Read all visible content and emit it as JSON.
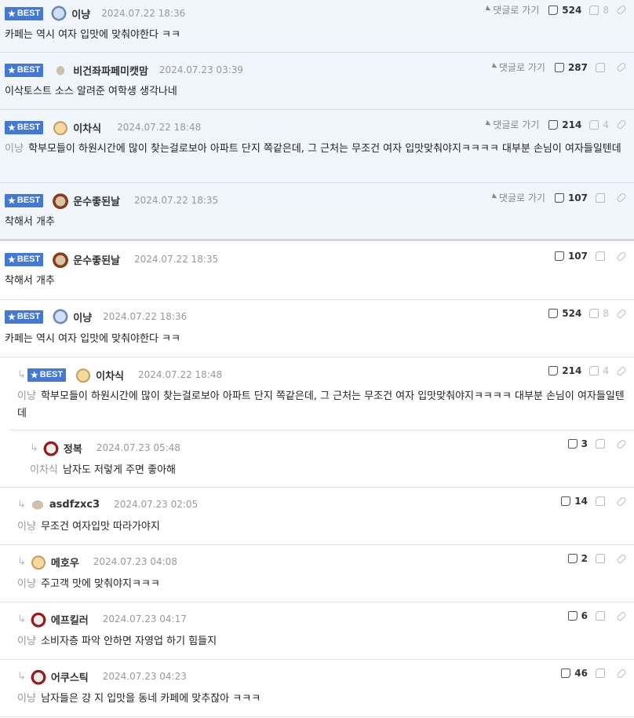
{
  "best_comments": [
    {
      "badge": "BEST",
      "nick": "이냥",
      "date": "2024.07.22 18:36",
      "reply_label": "댓글로 가기",
      "likes": "524",
      "dislikes": "8",
      "text": "카페는 역시 여자 입맛에 맞춰야한다 ㅋㅋ",
      "ref": ""
    },
    {
      "badge": "BEST",
      "nick": "비건좌파페미캣맘",
      "date": "2024.07.23 03:39",
      "reply_label": "댓글로 가기",
      "likes": "287",
      "dislikes": "",
      "text": "이삭토스트 소스 알려준 여학생 생각나네",
      "ref": ""
    },
    {
      "badge": "BEST",
      "nick": "이차식",
      "date": "2024.07.22 18:48",
      "reply_label": "댓글로 가기",
      "likes": "214",
      "dislikes": "4",
      "text": "학부모들이 하원시간에 많이 찾는걸로보아 아파트 단지 쪽같은데, 그 근처는 무조건 여자 입맛맞춰야지ㅋㅋㅋㅋ 대부분 손님이 여자들일텐데",
      "ref": "이냥"
    },
    {
      "badge": "BEST",
      "nick": "운수좋된날",
      "date": "2024.07.22 18:35",
      "reply_label": "댓글로 가기",
      "likes": "107",
      "dislikes": "",
      "text": "착해서 개추",
      "ref": ""
    }
  ],
  "comments": [
    {
      "badge": "BEST",
      "nick": "운수좋된날",
      "date": "2024.07.22 18:35",
      "likes": "107",
      "dislikes": "",
      "text": "착해서 개추",
      "ref": ""
    },
    {
      "badge": "BEST",
      "nick": "이냥",
      "date": "2024.07.22 18:36",
      "likes": "524",
      "dislikes": "8",
      "text": "카페는 역시 여자 입맛에 맞춰야한다 ㅋㅋ",
      "ref": ""
    },
    {
      "badge": "BEST",
      "nick": "이차식",
      "date": "2024.07.22 18:48",
      "likes": "214",
      "dislikes": "4",
      "text": "학부모들이 하원시간에 많이 찾는걸로보아 아파트 단지 쪽같은데, 그 근처는 무조건 여자 입맛맞춰야지ㅋㅋㅋㅋ 대부분 손님이 여자들일텐데",
      "ref": "이냥"
    },
    {
      "badge": "",
      "nick": "정복",
      "date": "2024.07.23 05:48",
      "likes": "3",
      "dislikes": "",
      "text": "남자도 저렇게 주면 좋아해",
      "ref": "이차식"
    },
    {
      "badge": "",
      "nick": "asdfzxc3",
      "date": "2024.07.23 02:05",
      "likes": "14",
      "dislikes": "",
      "text": "무조건 여자입맛 따라가야지",
      "ref": "이냥"
    },
    {
      "badge": "",
      "nick": "메호우",
      "date": "2024.07.23 04:08",
      "likes": "2",
      "dislikes": "",
      "text": "주고객 맛에 맞춰야지ㅋㅋㅋ",
      "ref": "이냥"
    },
    {
      "badge": "",
      "nick": "에프킬러",
      "date": "2024.07.23 04:17",
      "likes": "6",
      "dislikes": "",
      "text": "소비자층 파악 안하면 자영업 하기 힘들지",
      "ref": "이냥"
    },
    {
      "badge": "",
      "nick": "어쿠스틱",
      "date": "2024.07.23 04:23",
      "likes": "46",
      "dislikes": "",
      "text": "남자들은 걍 지 입맛을 동네 카페에 맞추잖아 ㅋㅋㅋ",
      "ref": "이냥"
    }
  ],
  "colors": {
    "accent": "#4378d4",
    "best_bg": "#f1f5fc",
    "muted": "#999999"
  }
}
